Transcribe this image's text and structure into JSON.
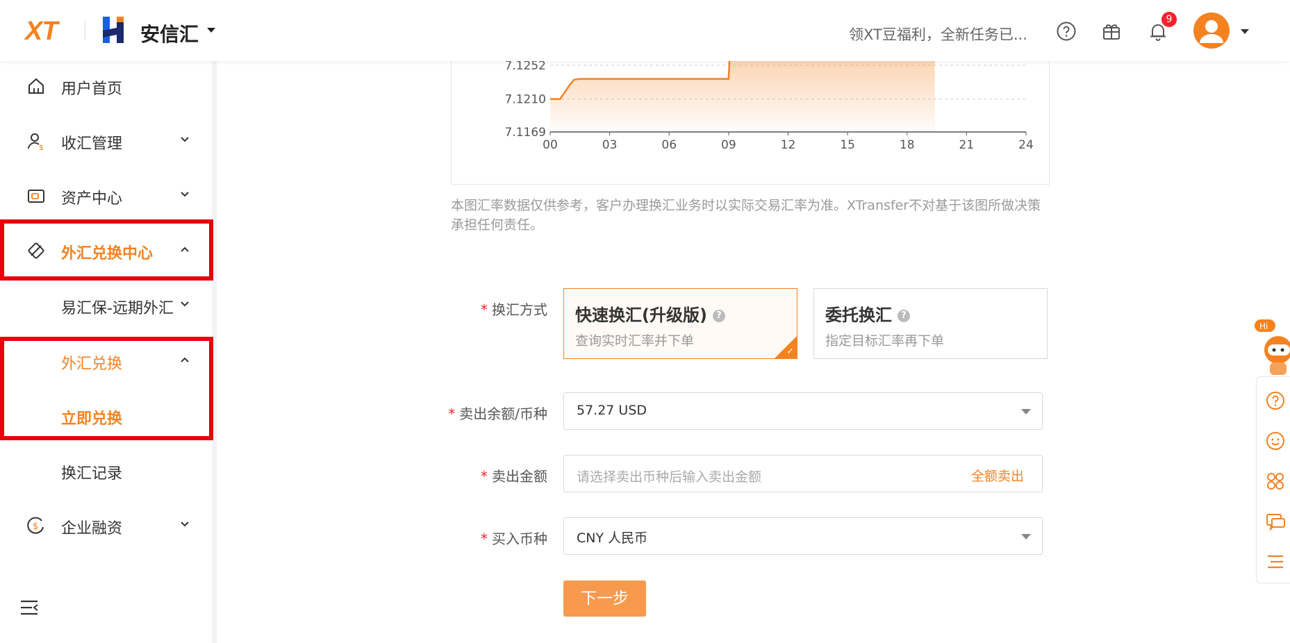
{
  "header": {
    "logo_text": "XT",
    "brand": "安信汇",
    "promo": "领XT豆福利，全新任务已...",
    "notification_count": "9",
    "accent_color": "#f58220",
    "icons": [
      "help-icon",
      "gift-icon",
      "bell-icon",
      "avatar",
      "chevron-down-icon"
    ]
  },
  "sidebar": {
    "items": [
      {
        "label": "用户首页",
        "icon": "home-icon"
      },
      {
        "label": "收汇管理",
        "icon": "user-dollar-icon"
      },
      {
        "label": "资产中心",
        "icon": "wallet-icon"
      },
      {
        "label": "外汇兑换中心",
        "icon": "exchange-tag-icon"
      },
      {
        "label": "易汇保-远期外汇"
      },
      {
        "label": "外汇兑换"
      },
      {
        "label": "立即兑换"
      },
      {
        "label": "换汇记录"
      },
      {
        "label": "企业融资",
        "icon": "dollar-cycle-icon"
      }
    ]
  },
  "chart_data": {
    "type": "line",
    "yticks": [
      "7.1252",
      "7.1210",
      "7.1169"
    ],
    "xticks": [
      "00",
      "03",
      "06",
      "09",
      "12",
      "15",
      "18",
      "21",
      "24"
    ],
    "x": [
      0,
      0.5,
      1,
      1.2,
      1.5,
      2,
      3,
      5,
      8,
      9,
      9.05,
      10,
      12,
      14,
      16,
      18,
      19.4
    ],
    "y": [
      7.121,
      7.121,
      7.1228,
      7.1234,
      7.1235,
      7.1235,
      7.1235,
      7.1235,
      7.1235,
      7.1235,
      7.1262,
      7.1262,
      7.1262,
      7.1262,
      7.1262,
      7.1262,
      7.1262
    ],
    "ylim": [
      7.1169,
      7.1252
    ],
    "xlim": [
      0,
      24
    ],
    "grid": true,
    "color": "#f58220"
  },
  "main": {
    "disclaimer": "本图汇率数据仅供参考，客户办理换汇业务时以实际交易汇率为准。XTransfer不对基于该图所做决策承担任何责任。",
    "method_label": "换汇方式",
    "methods": [
      {
        "title": "快速换汇(升级版)",
        "desc": "查询实时汇率并下单",
        "q": "?"
      },
      {
        "title": "委托换汇",
        "desc": "指定目标汇率再下单",
        "q": "?"
      }
    ],
    "sell_balance_label": "卖出余额/币种",
    "sell_balance_value": "57.27 USD",
    "sell_amount_label": "卖出金额",
    "sell_amount_placeholder": "请选择卖出币种后输入卖出金额",
    "sell_all": "全额卖出",
    "buy_currency_label": "买入币种",
    "buy_currency_value": "CNY 人民币",
    "next_button": "下一步",
    "required_mark": "*"
  },
  "assistant": {
    "bubble": "Hi",
    "panel_icons": [
      "help-circle-icon",
      "smile-icon",
      "apps-icon",
      "chat-icon",
      "list-icon"
    ]
  }
}
